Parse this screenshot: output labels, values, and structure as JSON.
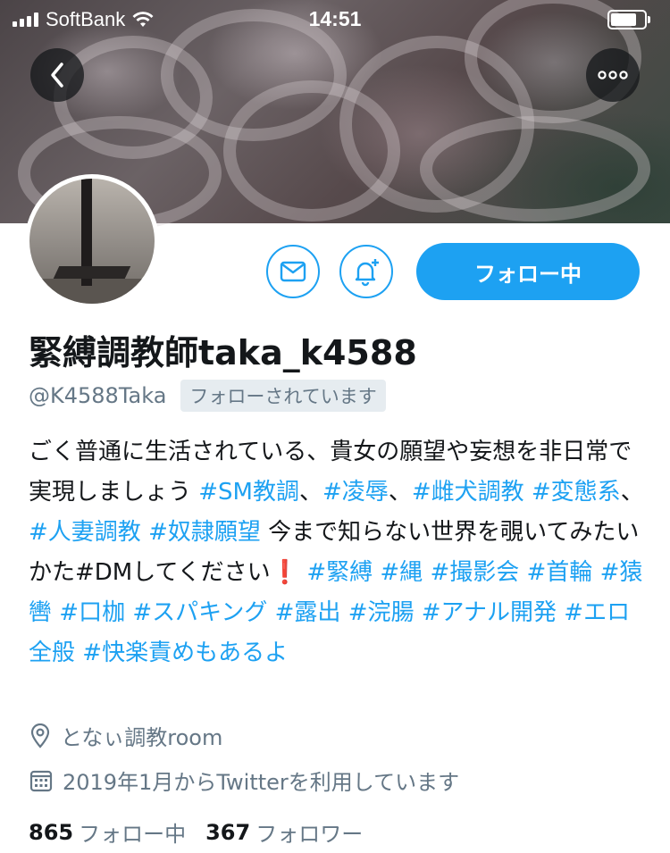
{
  "status_bar": {
    "carrier": "SoftBank",
    "time": "14:51"
  },
  "profile": {
    "display_name": "緊縛調教師taka_k4588",
    "handle": "@K4588Taka",
    "follows_you_badge": "フォローされています",
    "follow_button_label": "フォロー中",
    "location": "となぃ調教room",
    "joined": "2019年1月からTwitterを利用しています",
    "following_count": "865",
    "following_label": "フォロー中",
    "followers_count": "367",
    "followers_label": "フォロワー"
  },
  "bio": {
    "t1": "ごく普通に生活されている、貴女の願望や妄想を非日常で実現しましょう ",
    "h1": "#SM教調",
    "s1": "、",
    "h2": "#凌辱",
    "s2": "、",
    "h3": "#雌犬調教",
    "s3": " ",
    "h4": "#変態系",
    "s4": "、",
    "h5": "#人妻調教",
    "s5": " ",
    "h6": "#奴隷願望",
    "t2": " 今まで知らない世界を覗いてみたい かた#DMしてください",
    "excl": "❗",
    "h7": "#緊縛",
    "h8": "#縄",
    "h9": "#撮影会",
    "h10": "#首輪",
    "h11": "#猿轡",
    "h12": "#口枷",
    "h13": "#スパキング",
    "h14": "#露出",
    "h15": "#浣腸",
    "h16": "#アナル開発",
    "h17": "#エロ全般",
    "h18": "#快楽責め",
    "t3": "もあるよ"
  },
  "colors": {
    "accent": "#1da1f2",
    "muted": "#657786",
    "text": "#14171a"
  },
  "icons": {
    "back": "chevron-left-icon",
    "more": "more-dots-icon",
    "mail": "mail-icon",
    "bell": "bell-plus-icon",
    "location": "location-pin-icon",
    "calendar": "calendar-icon"
  }
}
